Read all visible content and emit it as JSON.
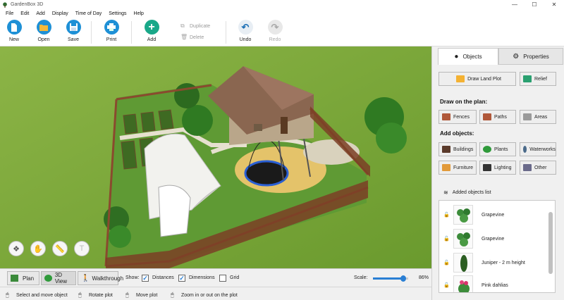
{
  "app": {
    "title": "GardenBox 3D"
  },
  "window": {
    "minimize": "—",
    "maximize": "☐",
    "close": "✕"
  },
  "menu": [
    "File",
    "Edit",
    "Add",
    "Display",
    "Time of Day",
    "Settings",
    "Help"
  ],
  "toolbar": {
    "new": "New",
    "open": "Open",
    "save": "Save",
    "print": "Print",
    "add": "Add",
    "duplicate": "Duplicate",
    "delete": "Delete",
    "undo": "Undo",
    "redo": "Redo"
  },
  "panel": {
    "tabs": {
      "objects": "Objects",
      "properties": "Properties"
    },
    "draw_land_plot": "Draw Land Plot",
    "relief": "Relief",
    "draw_on_plan": "Draw on the plan:",
    "draw_items": {
      "fences": "Fences",
      "paths": "Paths",
      "areas": "Areas"
    },
    "add_objects": "Add objects:",
    "object_items": {
      "buildings": "Buildings",
      "plants": "Plants",
      "waterworks": "Waterworks",
      "furniture": "Furniture",
      "lighting": "Lighting",
      "other": "Other"
    },
    "added_list_title": "Added objects list",
    "added_objects": [
      {
        "name": "Grapevine"
      },
      {
        "name": "Grapevine"
      },
      {
        "name": "Juniper - 2 m height"
      },
      {
        "name": "Pink dahlias"
      }
    ]
  },
  "viewbar": {
    "plan": "Plan",
    "view3d": "3D View",
    "walkthrough": "Walkthrough",
    "show_label": "Show:",
    "distances": {
      "label": "Distances",
      "checked": true
    },
    "dimensions": {
      "label": "Dimensions",
      "checked": true
    },
    "grid": {
      "label": "Grid",
      "checked": false
    },
    "scale_label": "Scale:",
    "scale_value": "86%",
    "scale_fraction": 0.86
  },
  "status": {
    "select": "Select and move object",
    "rotate": "Rotate plot",
    "move": "Move plot",
    "zoom": "Zoom in or out on the plot"
  },
  "colors": {
    "accent_blue": "#1e90d6",
    "add_green": "#1aa889",
    "grass": "#7aa83a",
    "fence": "#8a4a2e",
    "trampoline_rim": "#2a5fd4"
  }
}
